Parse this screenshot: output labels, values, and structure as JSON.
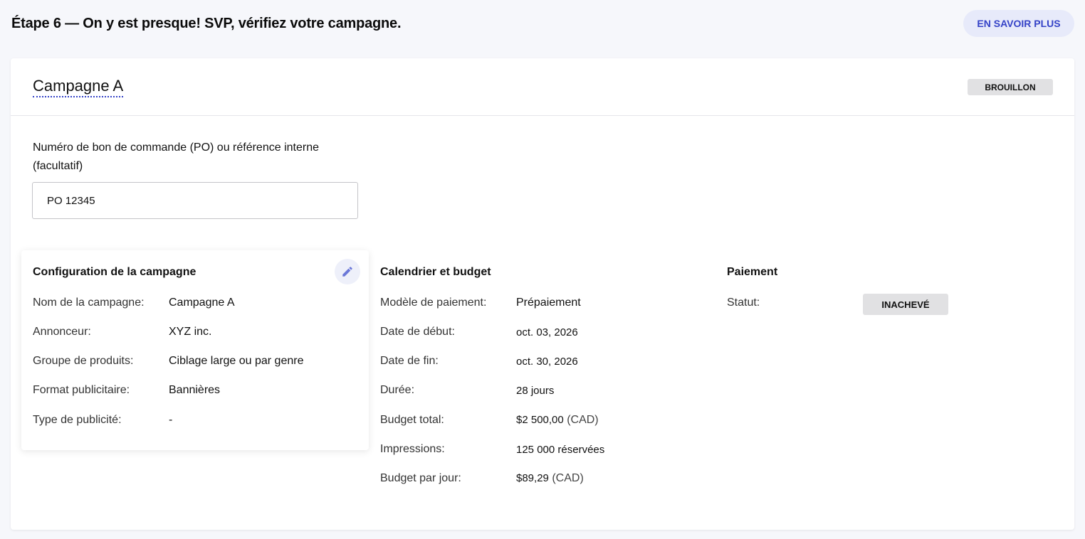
{
  "header": {
    "step_title": "Étape 6 — On y est presque! SVP, vérifiez votre campagne.",
    "learn_more": "EN SAVOIR PLUS"
  },
  "campaign": {
    "name": "Campagne A",
    "status": "BROUILLON"
  },
  "po": {
    "label_line1": "Numéro de bon de commande (PO) ou référence interne",
    "label_line2": "(facultatif)",
    "value": "PO 12345"
  },
  "config": {
    "title": "Configuration de la campagne",
    "rows": [
      {
        "label": "Nom de la campagne:",
        "value": "Campagne A"
      },
      {
        "label": "Annonceur:",
        "value": "XYZ inc."
      },
      {
        "label": "Groupe de produits:",
        "value": "Ciblage large ou par genre"
      },
      {
        "label": "Format publicitaire:",
        "value": "Bannières"
      },
      {
        "label": "Type de publicité:",
        "value": "-"
      }
    ]
  },
  "schedule": {
    "title": "Calendrier et budget",
    "rows": [
      {
        "label": "Modèle de paiement:",
        "value": "Prépaiement"
      },
      {
        "label": "Date de début:",
        "value": "oct. 03, 2026"
      },
      {
        "label": "Date de fin:",
        "value": "oct. 30, 2026"
      },
      {
        "label": "Durée:",
        "value": "28 jours"
      },
      {
        "label": "Budget total:",
        "value": "$2 500,00",
        "suffix": "(CAD)"
      },
      {
        "label": "Impressions:",
        "value": "125 000 réservées"
      },
      {
        "label": "Budget par jour:",
        "value": "$89,29",
        "suffix": "(CAD)"
      }
    ]
  },
  "payment": {
    "title": "Paiement",
    "status_label": "Statut:",
    "status_value": "INACHEVÉ"
  },
  "colors": {
    "accent": "#3442c7",
    "background": "#f6f7fb",
    "badge": "#e1e1e3"
  }
}
